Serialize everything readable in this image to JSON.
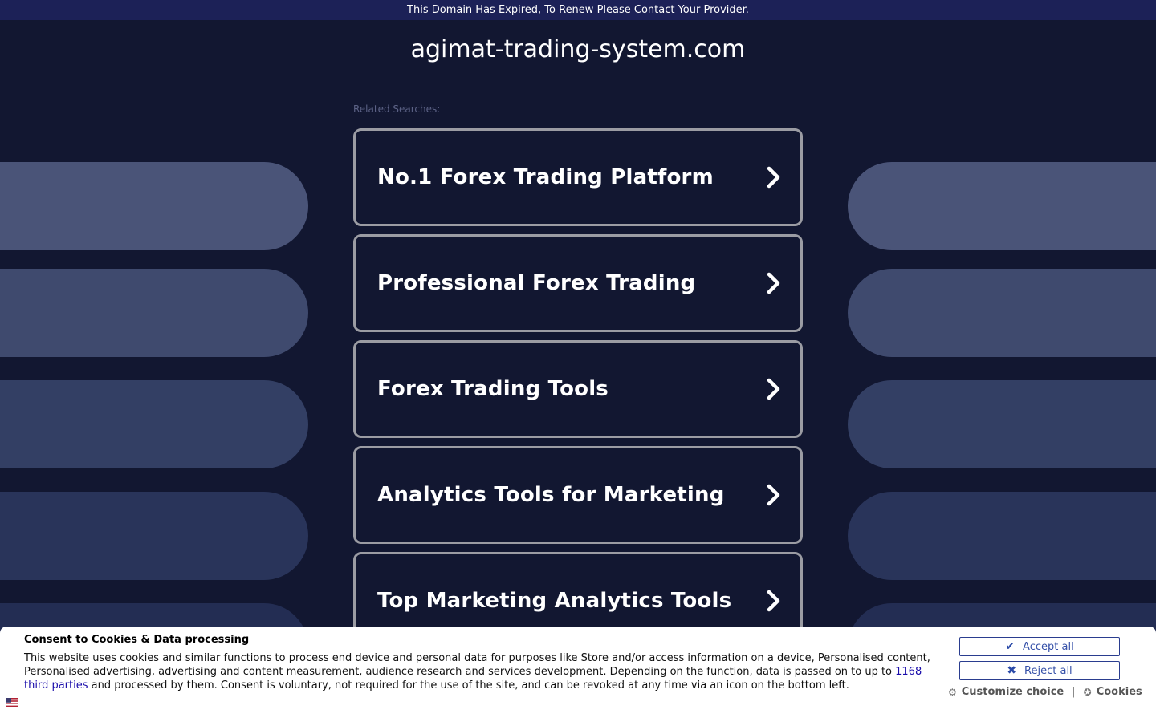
{
  "banner": {
    "text": "This Domain Has Expired, To Renew Please Contact Your Provider."
  },
  "header": {
    "domain": "agimat-trading-system.com"
  },
  "related": {
    "label": "Related Searches:",
    "items": [
      {
        "label": "No.1 Forex Trading Platform"
      },
      {
        "label": "Professional Forex Trading"
      },
      {
        "label": "Forex Trading Tools"
      },
      {
        "label": "Analytics Tools for Marketing"
      },
      {
        "label": "Top Marketing Analytics Tools"
      }
    ]
  },
  "consent": {
    "title": "Consent to Cookies & Data processing",
    "text_before": "This website uses cookies and similar functions to process end device and personal data for purposes like Store and/or access information on a device, Personalised content, Personalised advertising, advertising and content measurement, audience research and services development. Depending on the function, data is passed on to up to ",
    "link": "1168 third parties",
    "text_after": " and processed by them. Consent is voluntary, not required for the use of the site, and can be revoked at any time via an icon on the bottom left.",
    "accept_label": "Accept all",
    "reject_label": "Reject all",
    "customize_label": "Customize choice",
    "cookies_label": "Cookies",
    "separator": "|"
  },
  "icons": {
    "accept": "check-icon",
    "reject": "x-icon",
    "customize": "gear-icon",
    "cookies": "cookie-icon",
    "item_arrow": "chevron-right-icon",
    "language": "flag-icon"
  },
  "colors": {
    "background": "#121731",
    "banner": "#1c2157",
    "item_border": "#9b9ca3",
    "pill_1": "#4a5478",
    "pill_2": "#3f4a6e",
    "pill_3": "#333f64",
    "pill_4": "#29345a",
    "pill_5": "#232d53"
  }
}
